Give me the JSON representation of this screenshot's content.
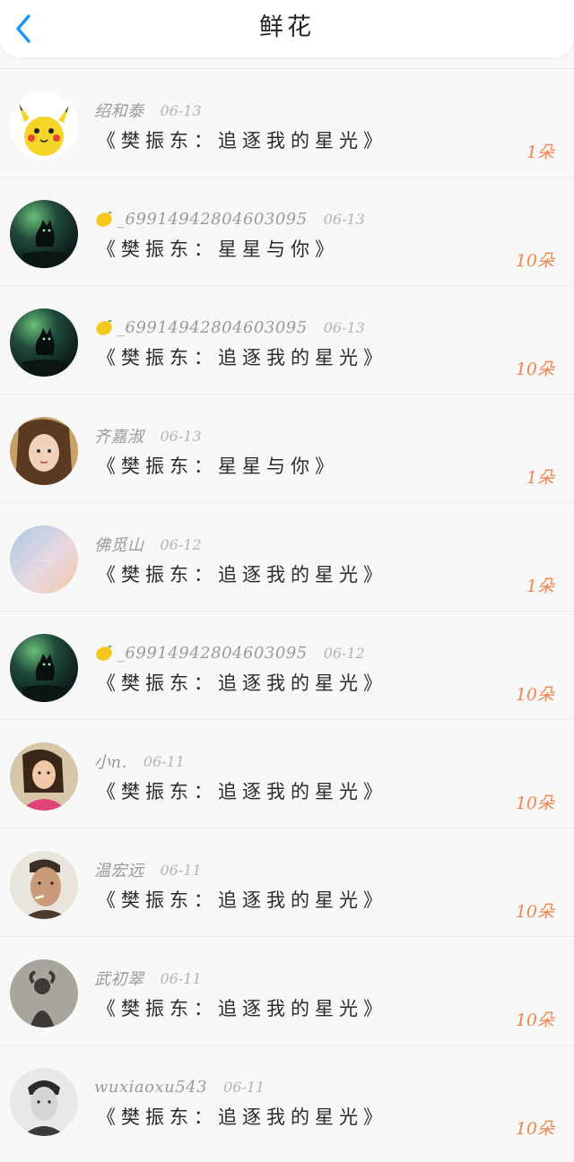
{
  "header": {
    "title": "鲜花",
    "back_icon": "chevron-left-icon",
    "accent_color": "#1e90ff"
  },
  "items": [
    {
      "avatar": "pikachu",
      "lemon": false,
      "name": "绍和泰",
      "date": "06-13",
      "work": "《樊振东：追逐我的星光》",
      "count": "1朵"
    },
    {
      "avatar": "cat",
      "lemon": true,
      "name": "_6991494280460309​5",
      "date": "06-13",
      "work": "《樊振东：星星与你》",
      "count": "10朵"
    },
    {
      "avatar": "cat",
      "lemon": true,
      "name": "_6991494280460309​5",
      "date": "06-13",
      "work": "《樊振东：追逐我的星光》",
      "count": "10朵"
    },
    {
      "avatar": "girl",
      "lemon": false,
      "name": "齐嘉淑",
      "date": "06-13",
      "work": "《樊振东：星星与你》",
      "count": "1朵"
    },
    {
      "avatar": "pastel",
      "lemon": false,
      "name": "佛觅山",
      "date": "06-12",
      "work": "《樊振东：追逐我的星光》",
      "count": "1朵"
    },
    {
      "avatar": "cat",
      "lemon": true,
      "name": "_6991494280460309​5",
      "date": "06-12",
      "work": "《樊振东：追逐我的星光》",
      "count": "10朵"
    },
    {
      "avatar": "woman",
      "lemon": false,
      "name": "小n.",
      "date": "06-11",
      "work": "《樊振东：追逐我的星光》",
      "count": "10朵"
    },
    {
      "avatar": "man",
      "lemon": false,
      "name": "温宏远",
      "date": "06-11",
      "work": "《樊振东：追逐我的星光》",
      "count": "10朵"
    },
    {
      "avatar": "silhouette",
      "lemon": false,
      "name": "武初翠",
      "date": "06-11",
      "work": "《樊振东：追逐我的星光》",
      "count": "10朵"
    },
    {
      "avatar": "bw",
      "lemon": false,
      "name": "wuxiaoxu543",
      "date": "06-11",
      "work": "《樊振东：追逐我的星光》",
      "count": "10朵"
    }
  ],
  "colors": {
    "count": "#f0864e",
    "name": "#9a9a9a",
    "date": "#b4b4b4",
    "work": "#2b2b2b"
  }
}
